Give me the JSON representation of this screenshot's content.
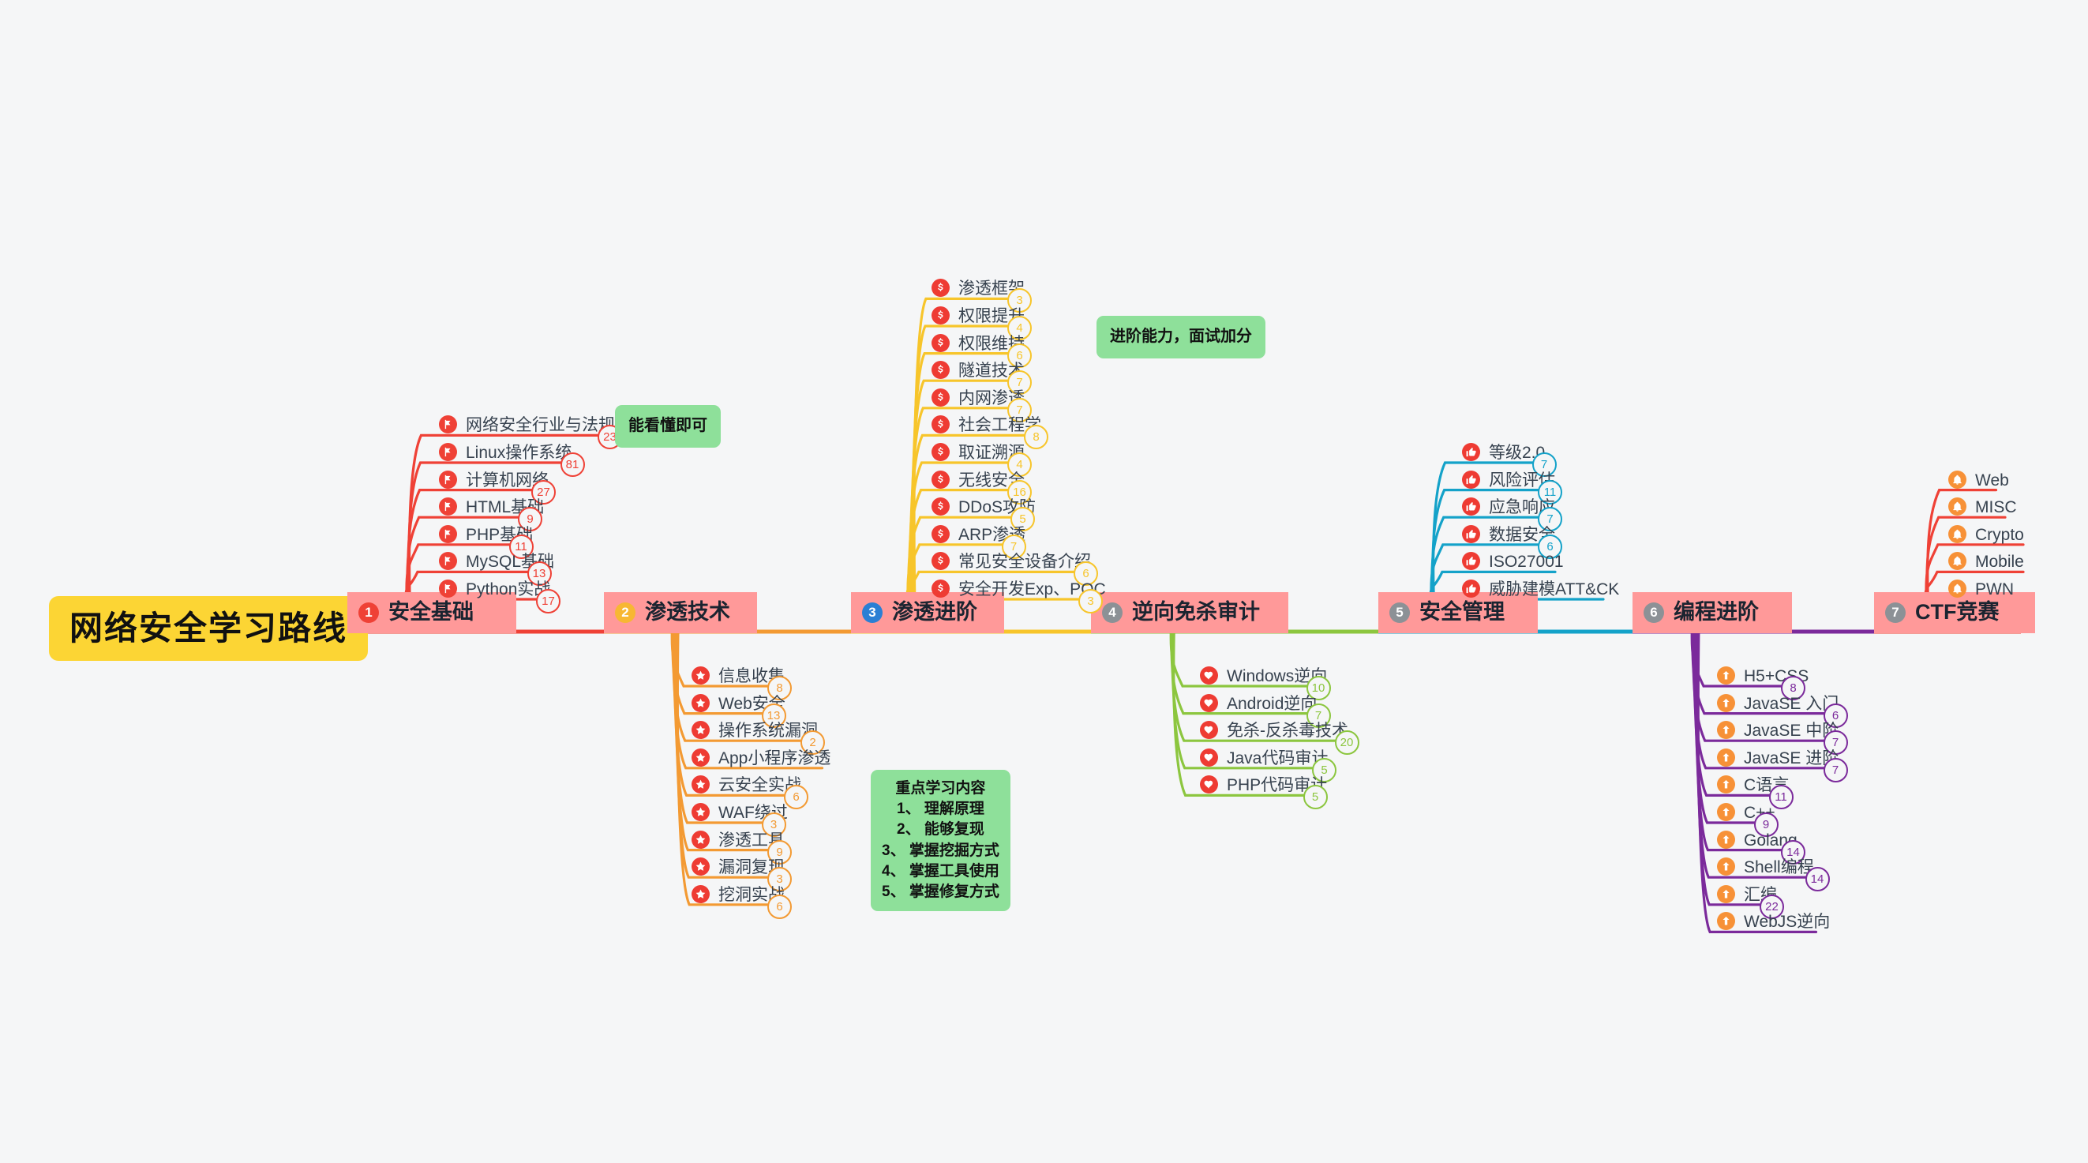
{
  "title": "网络安全学习路线",
  "colors": {
    "root_bg": "#fcd534",
    "branch_bg": "#ff9999",
    "note_bg": "#8ee09a",
    "b1": "#ef4136",
    "b2": "#f39a33",
    "b3": "#f7c52b",
    "b4": "#8cc63f",
    "b5": "#14a2c9",
    "b6": "#7b2a9b",
    "b7": "#ef4136"
  },
  "branches": [
    {
      "num": "1",
      "num_color": "#ef4136",
      "label": "安全基础",
      "color": "#ef4136",
      "icon": "flag-icon",
      "icon_bg": "#ef4136",
      "side": "up",
      "items": [
        {
          "label": "网络安全行业与法规",
          "count": "23"
        },
        {
          "label": "Linux操作系统",
          "count": "81"
        },
        {
          "label": "计算机网络",
          "count": "27"
        },
        {
          "label": "HTML基础",
          "count": "9"
        },
        {
          "label": "PHP基础",
          "count": "11"
        },
        {
          "label": "MySQL基础",
          "count": "13"
        },
        {
          "label": "Python实战",
          "count": "17"
        }
      ]
    },
    {
      "num": "2",
      "num_color": "#f7b733",
      "label": "渗透技术",
      "color": "#f39a33",
      "icon": "star-icon",
      "icon_bg": "#ee3b33",
      "side": "down",
      "items": [
        {
          "label": "信息收集",
          "count": "8"
        },
        {
          "label": "Web安全",
          "count": "13"
        },
        {
          "label": "操作系统漏洞",
          "count": "2"
        },
        {
          "label": "App小程序渗透",
          "count": ""
        },
        {
          "label": "云安全实战",
          "count": "6"
        },
        {
          "label": "WAF绕过",
          "count": "3"
        },
        {
          "label": "渗透工具",
          "count": "9"
        },
        {
          "label": "漏洞复现",
          "count": "3"
        },
        {
          "label": "挖洞实战",
          "count": "6"
        }
      ]
    },
    {
      "num": "3",
      "num_color": "#2b7fd4",
      "label": "渗透进阶",
      "color": "#f7c52b",
      "icon": "dollar-icon",
      "icon_bg": "#ee3b33",
      "side": "up",
      "items": [
        {
          "label": "渗透框架",
          "count": "3"
        },
        {
          "label": "权限提升",
          "count": "4"
        },
        {
          "label": "权限维持",
          "count": "6"
        },
        {
          "label": "隧道技术",
          "count": "7"
        },
        {
          "label": "内网渗透",
          "count": "7"
        },
        {
          "label": "社会工程学",
          "count": "8"
        },
        {
          "label": "取证溯源",
          "count": "4"
        },
        {
          "label": "无线安全",
          "count": "16"
        },
        {
          "label": "DDoS攻防",
          "count": "5"
        },
        {
          "label": "ARP渗透",
          "count": "7"
        },
        {
          "label": "常见安全设备介绍",
          "count": "6"
        },
        {
          "label": "安全开发Exp、POC",
          "count": "3"
        }
      ]
    },
    {
      "num": "4",
      "num_color": "#8c9196",
      "label": "逆向免杀审计",
      "color": "#8cc63f",
      "icon": "heart-icon",
      "icon_bg": "#ee3b33",
      "side": "down",
      "items": [
        {
          "label": "Windows逆向",
          "count": "10"
        },
        {
          "label": "Android逆向",
          "count": "7"
        },
        {
          "label": "免杀-反杀毒技术",
          "count": "20"
        },
        {
          "label": "Java代码审计",
          "count": "5"
        },
        {
          "label": "PHP代码审计",
          "count": "5"
        }
      ]
    },
    {
      "num": "5",
      "num_color": "#8c9196",
      "label": "安全管理",
      "color": "#14a2c9",
      "icon": "thumbs-up-icon",
      "icon_bg": "#ee3b33",
      "side": "up",
      "items": [
        {
          "label": "等级2.0",
          "count": "7"
        },
        {
          "label": "风险评估",
          "count": "11"
        },
        {
          "label": "应急响应",
          "count": "7"
        },
        {
          "label": "数据安全",
          "count": "6"
        },
        {
          "label": "ISO27001",
          "count": ""
        },
        {
          "label": "威胁建模ATT&CK",
          "count": ""
        }
      ]
    },
    {
      "num": "6",
      "num_color": "#8c9196",
      "label": "编程进阶",
      "color": "#7b2a9b",
      "icon": "arrow-up-icon",
      "icon_bg": "#f79137",
      "side": "down",
      "items": [
        {
          "label": "H5+CSS",
          "count": "8"
        },
        {
          "label": "JavaSE 入门",
          "count": "6"
        },
        {
          "label": "JavaSE 中阶",
          "count": "7"
        },
        {
          "label": "JavaSE 进阶",
          "count": "7"
        },
        {
          "label": "C语言",
          "count": "11"
        },
        {
          "label": "C++",
          "count": "9"
        },
        {
          "label": "Golang",
          "count": "14"
        },
        {
          "label": "Shell编程",
          "count": "14"
        },
        {
          "label": "汇编",
          "count": "22"
        },
        {
          "label": "WebJS逆向",
          "count": ""
        }
      ]
    },
    {
      "num": "7",
      "num_color": "#8c9196",
      "label": "CTF竞赛",
      "color": "#ef4136",
      "icon": "bell-icon",
      "icon_bg": "#f79137",
      "side": "up",
      "items": [
        {
          "label": "Web",
          "count": ""
        },
        {
          "label": "MISC",
          "count": ""
        },
        {
          "label": "Crypto",
          "count": ""
        },
        {
          "label": "Mobile",
          "count": ""
        },
        {
          "label": "PWN",
          "count": ""
        }
      ]
    }
  ],
  "notes": [
    {
      "text": "能看懂即可",
      "lines": 1
    },
    {
      "text": "进阶能力，面试加分",
      "lines": 1
    },
    {
      "text": "重点学习内容\n1、 理解原理\n2、 能够复现\n3、 掌握挖掘方式\n4、 掌握工具使用\n5、 掌握修复方式",
      "lines": 6
    }
  ]
}
